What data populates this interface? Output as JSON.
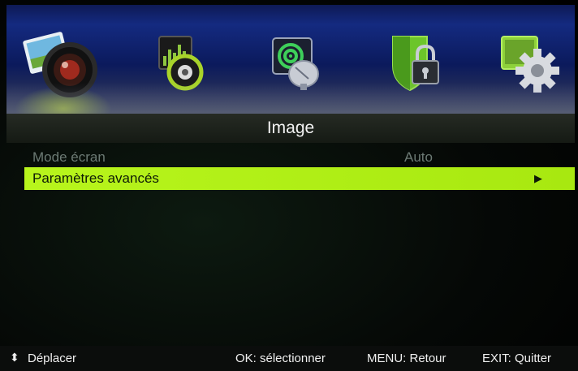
{
  "tabs": [
    {
      "icon": "picture-camera-icon",
      "active": true
    },
    {
      "icon": "sound-equalizer-icon",
      "active": false
    },
    {
      "icon": "channel-satellite-icon",
      "active": false
    },
    {
      "icon": "lock-shield-icon",
      "active": false
    },
    {
      "icon": "settings-gear-icon",
      "active": false
    }
  ],
  "menu": {
    "title": "Image",
    "items": [
      {
        "label": "Mode écran",
        "value": "Auto",
        "enabled": false
      },
      {
        "label": "Paramètres avancés",
        "value": "",
        "arrow": "▶",
        "selected": true
      }
    ]
  },
  "help": {
    "move_icon": "⬍",
    "move": "Déplacer",
    "ok": "OK: sélectionner",
    "menu": "MENU: Retour",
    "exit": "EXIT: Quitter"
  },
  "colors": {
    "accent": "#b8f51c",
    "iconbar": "#142a80",
    "disabled_text": "#6c7a74"
  }
}
